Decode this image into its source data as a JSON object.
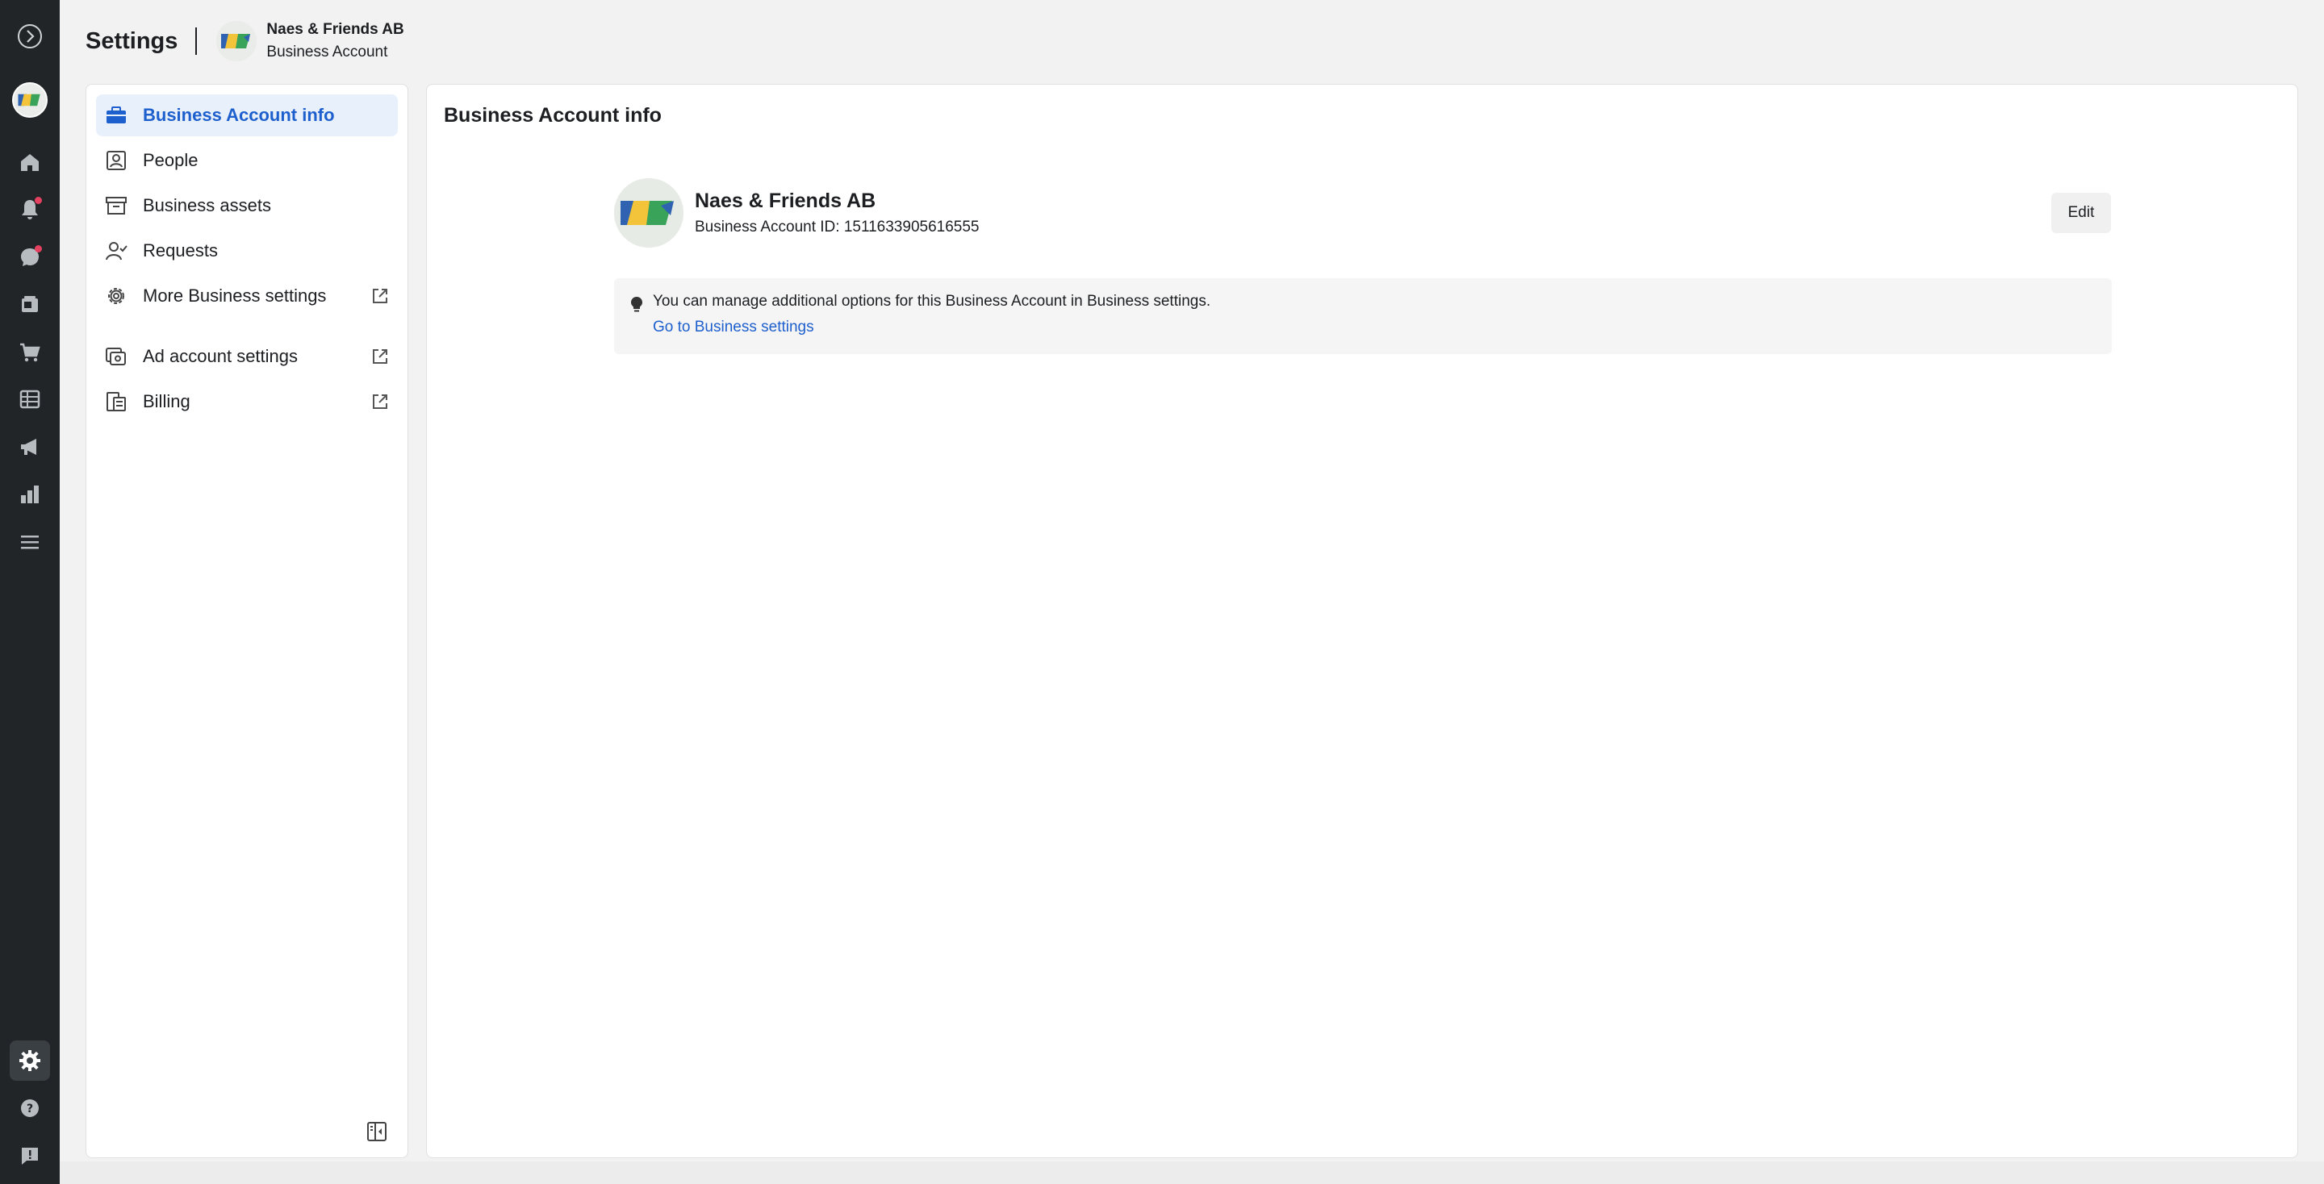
{
  "header": {
    "title": "Settings",
    "account_name": "Naes & Friends AB",
    "account_type": "Business Account"
  },
  "rail": {
    "items": [
      "meta-logo-icon",
      "avatar",
      "home-icon",
      "notifications-icon",
      "inbox-icon",
      "content-icon",
      "commerce-icon",
      "table-icon",
      "ads-icon",
      "insights-icon",
      "menu-icon",
      "settings-icon",
      "help-icon",
      "report-icon"
    ]
  },
  "nav": {
    "items": [
      {
        "label": "Business Account info",
        "active": true
      },
      {
        "label": "People"
      },
      {
        "label": "Business assets"
      },
      {
        "label": "Requests"
      },
      {
        "label": "More Business settings",
        "external": true
      },
      {
        "label": "Ad account settings",
        "external": true
      },
      {
        "label": "Billing",
        "external": true
      }
    ]
  },
  "main": {
    "title": "Business Account info",
    "business_name": "Naes & Friends AB",
    "business_id": "Business Account ID: 1511633905616555",
    "edit_label": "Edit",
    "info_text": "You can manage additional options for this Business Account in Business settings.",
    "info_link": "Go to Business settings"
  },
  "colors": {
    "accent": "#1e5fce",
    "rail_bg": "#212528",
    "active_bg": "#e8f0fc",
    "badge": "#e4405f"
  }
}
